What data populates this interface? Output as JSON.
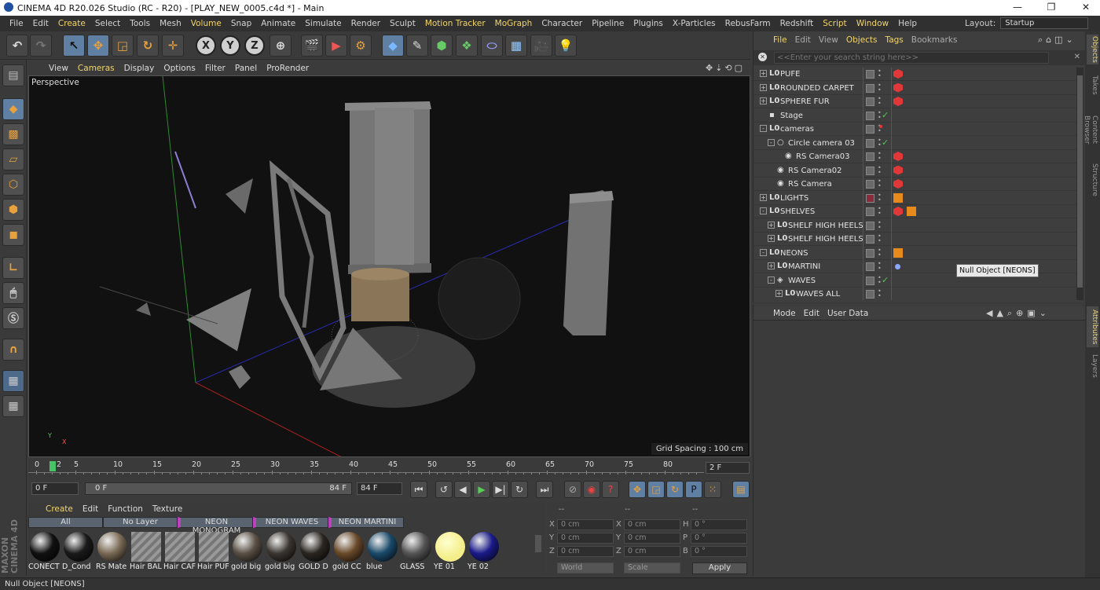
{
  "window": {
    "title": "CINEMA 4D R20.026 Studio (RC - R20) - [PLAY_NEW_0005.c4d *] - Main"
  },
  "menubar": [
    "File",
    "Edit",
    "Create",
    "Select",
    "Tools",
    "Mesh",
    "Volume",
    "Snap",
    "Animate",
    "Simulate",
    "Render",
    "Sculpt",
    "Motion Tracker",
    "MoGraph",
    "Character",
    "Pipeline",
    "Plugins",
    "X-Particles",
    "RebusFarm",
    "Redshift",
    "Script",
    "Window",
    "Help"
  ],
  "layout": {
    "label": "Layout:",
    "value": "Startup"
  },
  "viewport": {
    "menu": [
      "View",
      "Cameras",
      "Display",
      "Options",
      "Filter",
      "Panel",
      "ProRender"
    ],
    "label": "Perspective",
    "grid_spacing": "Grid Spacing : 100 cm"
  },
  "timeline": {
    "ticks": [
      "0",
      "2",
      "5",
      "10",
      "15",
      "20",
      "25",
      "30",
      "35",
      "40",
      "45",
      "50",
      "55",
      "60",
      "65",
      "70",
      "75",
      "80"
    ],
    "current_frame": "2 F",
    "start": "0 F",
    "range_start": "0 F",
    "range_end": "84 F",
    "end": "84 F"
  },
  "material_manager": {
    "menu": [
      "Create",
      "Edit",
      "Function",
      "Texture"
    ],
    "tabs": [
      "All",
      "No Layer",
      "NEON MONOGRAM",
      "NEON WAVES",
      "NEON MARTINI"
    ],
    "materials": [
      {
        "label": "CONECT",
        "color": "#111111"
      },
      {
        "label": "D_Cond",
        "color": "#1a1a1a"
      },
      {
        "label": "RS Mate",
        "color": "#7a6a55"
      },
      {
        "label": "Hair BAL",
        "color": "#888888"
      },
      {
        "label": "Hair CAF",
        "color": "#888888"
      },
      {
        "label": "Hair PUF",
        "color": "#888888"
      },
      {
        "label": "gold big",
        "color": "#5a5045"
      },
      {
        "label": "gold big",
        "color": "#3a3530"
      },
      {
        "label": "GOLD D",
        "color": "#2a2520"
      },
      {
        "label": "gold CC",
        "color": "#6a4a2a"
      },
      {
        "label": "blue",
        "color": "#1a4a6a"
      },
      {
        "label": "GLASS",
        "color": "#555555"
      },
      {
        "label": "YE 01",
        "color": "#f4ee8a"
      },
      {
        "label": "YE 02",
        "color": "#1a1a8a"
      }
    ]
  },
  "coordinates": {
    "headers": [
      "--",
      "--",
      "--"
    ],
    "rows": [
      {
        "a": "X",
        "av": "0 cm",
        "b": "X",
        "bv": "0 cm",
        "c": "H",
        "cv": "0 °"
      },
      {
        "a": "Y",
        "av": "0 cm",
        "b": "Y",
        "bv": "0 cm",
        "c": "P",
        "cv": "0 °"
      },
      {
        "a": "Z",
        "av": "0 cm",
        "b": "Z",
        "bv": "0 cm",
        "c": "B",
        "cv": "0 °"
      }
    ],
    "mode_world": "World",
    "mode_scale": "Scale",
    "apply": "Apply"
  },
  "objects_panel": {
    "menu": [
      "File",
      "Edit",
      "View",
      "Objects",
      "Tags",
      "Bookmarks"
    ],
    "search_placeholder": "<<Enter your search string here>>",
    "items": [
      {
        "name": "PUFE",
        "icon": "L0",
        "indent": 0,
        "exp": "+",
        "tag": "red"
      },
      {
        "name": "ROUNDED CARPET",
        "icon": "L0",
        "indent": 0,
        "exp": "+",
        "tag": "red"
      },
      {
        "name": "SPHERE FUR",
        "icon": "L0",
        "indent": 0,
        "exp": "+",
        "tag": "red"
      },
      {
        "name": "Stage",
        "icon": "▪",
        "indent": 0,
        "exp": "",
        "tag": "check"
      },
      {
        "name": "cameras",
        "icon": "L0",
        "indent": 0,
        "exp": "-",
        "tag": "dot"
      },
      {
        "name": "Circle camera 03",
        "icon": "○",
        "indent": 1,
        "exp": "-",
        "tag": "check"
      },
      {
        "name": "RS Camera03",
        "icon": "◉",
        "indent": 2,
        "exp": "",
        "tag": "redcam"
      },
      {
        "name": "RS Camera02",
        "icon": "◉",
        "indent": 1,
        "exp": "",
        "tag": "redcam"
      },
      {
        "name": "RS Camera",
        "icon": "◉",
        "indent": 1,
        "exp": "",
        "tag": "redcam"
      },
      {
        "name": "LIGHTS",
        "icon": "L0",
        "indent": 0,
        "exp": "+",
        "tag": "orange"
      },
      {
        "name": "SHELVES",
        "icon": "L0",
        "indent": 0,
        "exp": "-",
        "tag": "redorange"
      },
      {
        "name": "SHELF HIGH HEELS .2",
        "icon": "L0",
        "indent": 1,
        "exp": "+",
        "tag": ""
      },
      {
        "name": "SHELF HIGH HEELS",
        "icon": "L0",
        "indent": 1,
        "exp": "+",
        "tag": ""
      },
      {
        "name": "NEONS",
        "icon": "L0",
        "indent": 0,
        "exp": "-",
        "tag": "orange"
      },
      {
        "name": "MARTINI",
        "icon": "L0",
        "indent": 1,
        "exp": "+",
        "tag": "bluedot"
      },
      {
        "name": "WAVES",
        "icon": "◈",
        "indent": 1,
        "exp": "-",
        "tag": "check"
      },
      {
        "name": "WAVES ALL",
        "icon": "L0",
        "indent": 2,
        "exp": "+",
        "tag": ""
      }
    ],
    "tooltip": "Null Object [NEONS]"
  },
  "attributes_panel": {
    "menu": [
      "Mode",
      "Edit",
      "User Data"
    ]
  },
  "right_tabs": [
    "Objects",
    "Takes",
    "Content Browser",
    "Structure",
    "Attributes",
    "Layers"
  ],
  "logo_text": "MAXON CINEMA 4D",
  "status": "Null Object [NEONS]"
}
